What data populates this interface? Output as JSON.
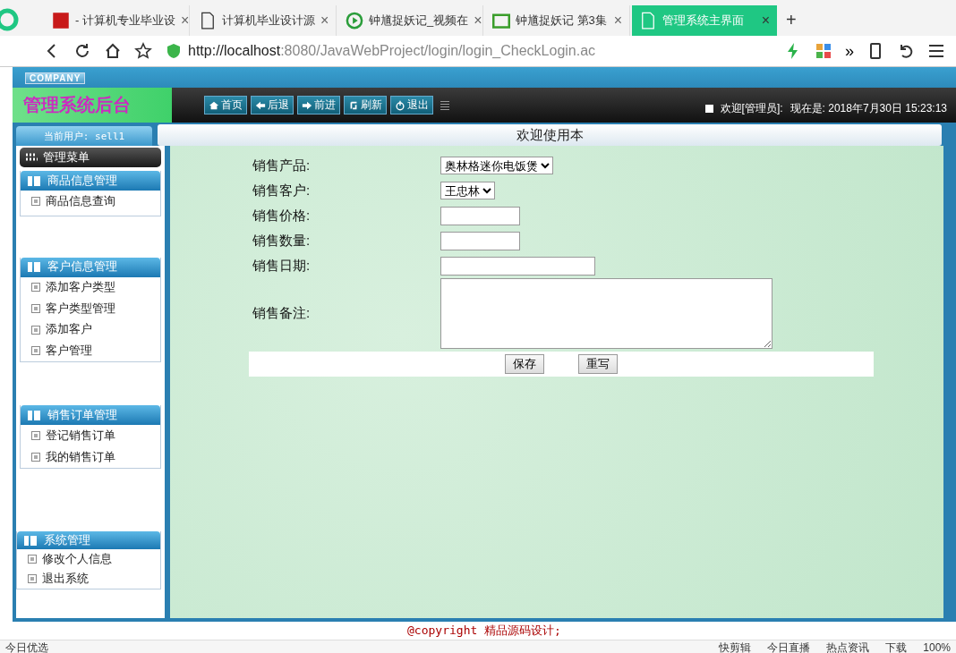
{
  "browser": {
    "tabs": [
      {
        "title": "- 计算机专业毕业设",
        "close": "×",
        "selected": false
      },
      {
        "title": "计算机毕业设计源",
        "close": "×",
        "selected": false
      },
      {
        "title": "钟馗捉妖记_视频在",
        "close": "×",
        "selected": false
      },
      {
        "title": "钟馗捉妖记 第3集",
        "close": "×",
        "selected": false
      },
      {
        "title": "管理系统主界面",
        "close": "×",
        "selected": true
      }
    ],
    "new_tab": "+",
    "url_host": "http://localhost",
    "url_path": ":8080/JavaWebProject/login/login_CheckLogin.ac",
    "more": "»"
  },
  "header": {
    "company": "COMPANY",
    "title": "管理系统后台",
    "nav": [
      "首页",
      "后退",
      "前进",
      "刷新",
      "退出"
    ],
    "welcome": "欢迎[管理员]:",
    "now": "现在是: 2018年7月30日 15:23:13"
  },
  "current_user": "当前用户: sell1",
  "page_title": "欢迎使用本",
  "sidebar": {
    "title": "管理菜单",
    "groups": [
      {
        "title": "商品信息管理",
        "items": [
          "商品信息查询"
        ]
      },
      {
        "title": "客户信息管理",
        "items": [
          "添加客户类型",
          "客户类型管理",
          "添加客户",
          "客户管理"
        ]
      },
      {
        "title": "销售订单管理",
        "items": [
          "登记销售订单",
          "我的销售订单"
        ]
      },
      {
        "title": "系统管理",
        "items": [
          "修改个人信息",
          "退出系统"
        ]
      }
    ]
  },
  "form": {
    "fields": [
      {
        "label": "销售产品:",
        "kind": "select",
        "value": "奥林格迷你电饭煲"
      },
      {
        "label": "销售客户:",
        "kind": "select",
        "value": "王忠林"
      },
      {
        "label": "销售价格:",
        "kind": "text"
      },
      {
        "label": "销售数量:",
        "kind": "text"
      },
      {
        "label": "销售日期:",
        "kind": "text"
      },
      {
        "label": "销售备注:",
        "kind": "textarea"
      }
    ],
    "buttons": [
      "保存",
      "重写"
    ]
  },
  "copyright": "@copyright 精品源码设计;",
  "status_bar": [
    "今日优选",
    "快剪辑",
    "今日直播",
    "热点资讯",
    "下载",
    "100%"
  ]
}
